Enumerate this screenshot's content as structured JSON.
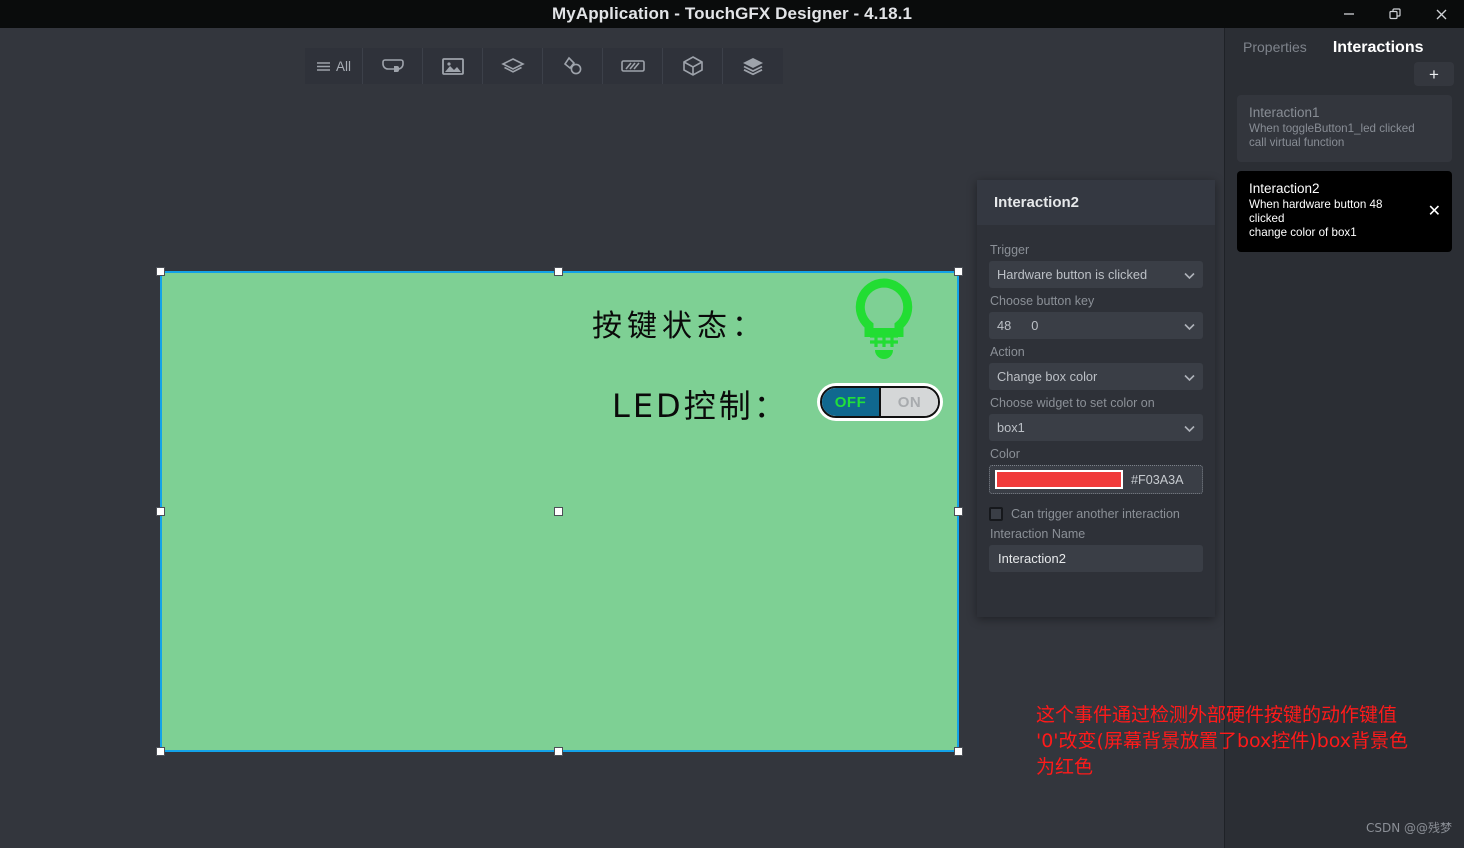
{
  "window": {
    "title": "MyApplication - TouchGFX Designer - 4.18.1",
    "controls": {
      "minimize": "minimize-icon",
      "restore": "restore-icon",
      "close": "close-icon"
    }
  },
  "toolbar": {
    "items": [
      {
        "label": "All",
        "icon": "hamburger-icon",
        "name": "tool-all"
      },
      {
        "label": "",
        "icon": "button-widget-icon",
        "name": "tool-button"
      },
      {
        "label": "",
        "icon": "image-icon",
        "name": "tool-image"
      },
      {
        "label": "",
        "icon": "shape-layers-icon",
        "name": "tool-shapes"
      },
      {
        "label": "",
        "icon": "drawing-icon",
        "name": "tool-drawing"
      },
      {
        "label": "",
        "icon": "gauge-icon",
        "name": "tool-gauge"
      },
      {
        "label": "",
        "icon": "cube-icon",
        "name": "tool-3d"
      },
      {
        "label": "",
        "icon": "stack-icon",
        "name": "tool-containers"
      }
    ]
  },
  "canvas": {
    "box": {
      "fill_color": "#7ED094",
      "selection_color": "#13A2E8",
      "selected": true
    },
    "labels": {
      "key_state": "按键状态：",
      "led_control": "LED控制："
    },
    "bulb": {
      "icon": "lightbulb-icon",
      "color": "#22DD33"
    },
    "toggle": {
      "off_label": "OFF",
      "on_label": "ON",
      "state": "OFF",
      "off_bg": "#10688F",
      "off_text": "#21E03A",
      "on_bg": "#D5D7D8",
      "on_text": "#A8ABAE"
    }
  },
  "editor": {
    "title": "Interaction2",
    "trigger_label": "Trigger",
    "trigger_value": "Hardware button is clicked",
    "button_key_label": "Choose button key",
    "button_key_value": "48",
    "button_key_value2": "0",
    "action_label": "Action",
    "action_value": "Change box color",
    "widget_label": "Choose widget to set color on",
    "widget_value": "box1",
    "color_label": "Color",
    "color_hex": "#F03A3A",
    "can_trigger_label": "Can trigger another interaction",
    "can_trigger_checked": false,
    "name_label": "Interaction Name",
    "name_value": "Interaction2"
  },
  "right_panel": {
    "tabs": [
      {
        "label": "Properties",
        "active": false
      },
      {
        "label": "Interactions",
        "active": true
      }
    ],
    "add_button": "+",
    "interactions": [
      {
        "title": "Interaction1",
        "line1": "When toggleButton1_led clicked",
        "line2": "call virtual function",
        "selected": false
      },
      {
        "title": "Interaction2",
        "line1": "When hardware button 48 clicked",
        "line2": "change color of box1",
        "selected": true,
        "close": "✕"
      }
    ]
  },
  "annotation": {
    "line1": "这个事件通过检测外部硬件按键的动作键值",
    "line2": "'0'改变(屏幕背景放置了box控件)box背景色",
    "line3": "为红色",
    "color": "#FF1A1A"
  },
  "watermark": "CSDN @@残梦"
}
